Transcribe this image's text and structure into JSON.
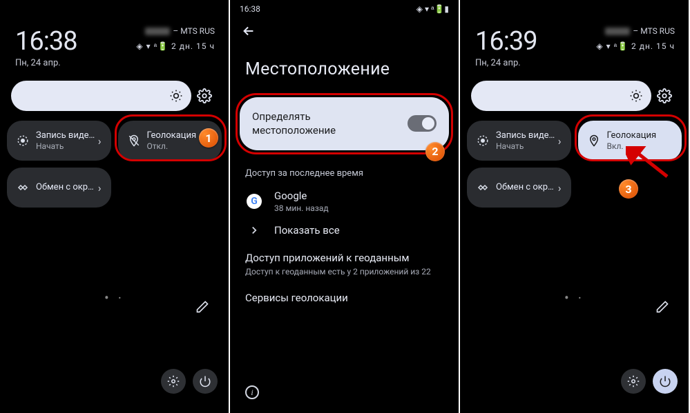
{
  "panel1": {
    "time": "16:38",
    "date": "Пн, 24 апр.",
    "carrier": "– MTS RUS",
    "status_text": "2 дн. 15 ч",
    "tiles": {
      "record": {
        "label": "Запись виде…",
        "sub": "Начать"
      },
      "geo": {
        "label": "Геолокация",
        "sub": "Откл."
      },
      "share": {
        "label": "Обмен с окр…"
      }
    },
    "step_badge": "1"
  },
  "panel2": {
    "status_time": "16:38",
    "title": "Местоположение",
    "toggle_line1": "Определять",
    "toggle_line2": "местоположение",
    "section_recent": "Доступ за последнее время",
    "google": {
      "name": "Google",
      "sub": "38 мин. назад"
    },
    "show_all": "Показать все",
    "app_access_title": "Доступ приложений к геоданным",
    "app_access_sub": "Доступ к геоданным есть у 2 приложений из 22",
    "services": "Сервисы геолокации",
    "step_badge": "2"
  },
  "panel3": {
    "time": "16:39",
    "date": "Пн, 24 апр.",
    "carrier": "– MTS RUS",
    "status_text": "2 дн. 15 ч",
    "tiles": {
      "record": {
        "label": "Запись виде…",
        "sub": "Начать"
      },
      "geo": {
        "label": "Геолокация",
        "sub": "Вкл."
      },
      "share": {
        "label": "Обмен с окр…"
      }
    },
    "step_badge": "3"
  }
}
